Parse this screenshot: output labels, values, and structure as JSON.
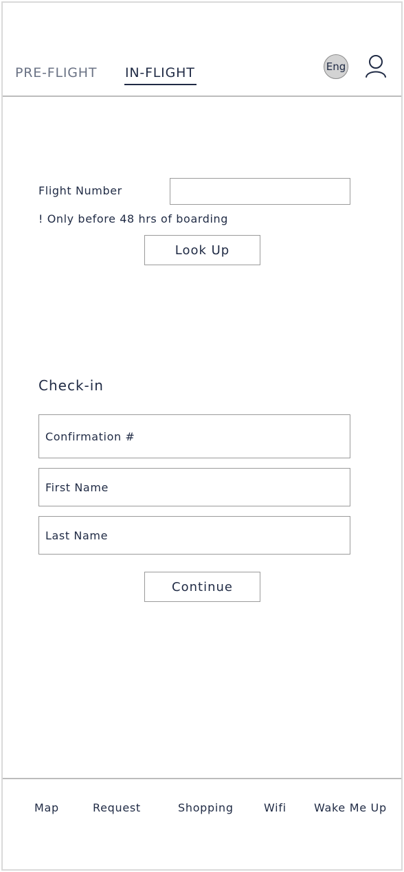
{
  "header": {
    "tabs": [
      {
        "label": "PRE-FLIGHT",
        "active": false
      },
      {
        "label": "IN-FLIGHT",
        "active": true
      }
    ],
    "language_label": "Eng",
    "profile_icon": "user-icon"
  },
  "flight_lookup": {
    "label": "Flight Number",
    "input_value": "",
    "note": "! Only before 48 hrs of boarding",
    "button_label": "Look Up"
  },
  "checkin": {
    "title": "Check-in",
    "fields": [
      {
        "placeholder": "Confirmation #",
        "value": ""
      },
      {
        "placeholder": "First Name",
        "value": ""
      },
      {
        "placeholder": "Last Name",
        "value": ""
      }
    ],
    "button_label": "Continue"
  },
  "bottom_nav": {
    "items": [
      {
        "label": "Map"
      },
      {
        "label": "Request"
      },
      {
        "label": "Shopping"
      },
      {
        "label": "Wifi"
      },
      {
        "label": "Wake Me Up"
      }
    ]
  },
  "colors": {
    "text": "#1f2a44",
    "muted_text": "#6a7284",
    "border": "#9a9a9a",
    "divider": "#bcbcbc",
    "badge_fill": "#d3d3d3"
  }
}
